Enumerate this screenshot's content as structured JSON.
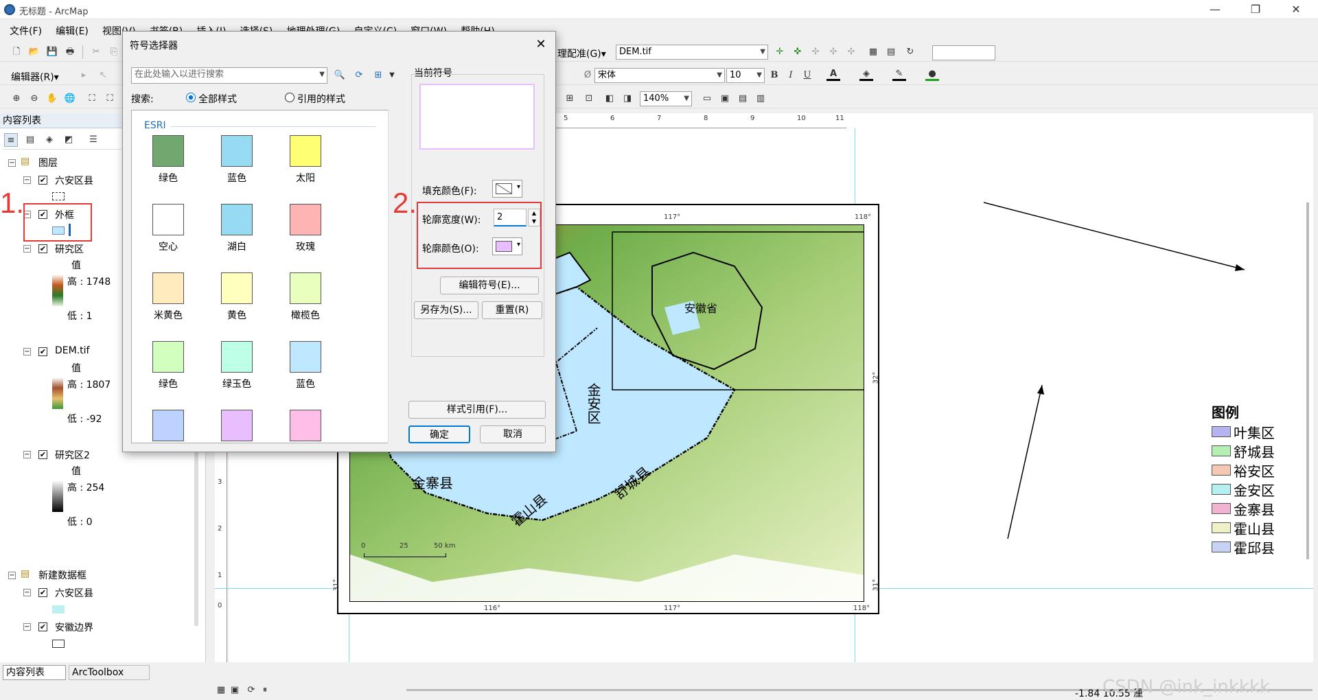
{
  "window": {
    "title": "无标题 - ArcMap",
    "min": "—",
    "max": "❐",
    "close": "✕"
  },
  "menu": [
    "文件(F)",
    "编辑(E)",
    "视图(V)",
    "书签(B)",
    "插入(I)",
    "选择(S)",
    "地理处理(G)",
    "自定义(C)",
    "窗口(W)",
    "帮助(H)"
  ],
  "toolbar": {
    "editor_label": "编辑器(R)▾",
    "georef_label": "理配准(G)▾",
    "georef_layer": "DEM.tif",
    "font_name": "宋体",
    "font_size": "10",
    "zoom": "140%",
    "bold": "B",
    "italic": "I",
    "underline": "U"
  },
  "toc": {
    "header": "内容列表",
    "layers_group": "图层",
    "layers": [
      {
        "name": "六安区县",
        "checked": true
      },
      {
        "name": "外框",
        "checked": true
      },
      {
        "name": "研究区",
        "checked": true,
        "value_label": "值",
        "high": "高 : 1748",
        "low": "低 : 1"
      },
      {
        "name": "DEM.tif",
        "checked": true,
        "value_label": "值",
        "high": "高 : 1807",
        "low": "低 : -92"
      },
      {
        "name": "研究区2",
        "checked": true,
        "value_label": "值",
        "high": "高 : 254",
        "low": "低 : 0"
      }
    ],
    "new_frame": "新建数据框",
    "new_frame_layers": [
      {
        "name": "六安区县",
        "checked": true
      },
      {
        "name": "安徽边界",
        "checked": true
      }
    ],
    "tabs": [
      "内容列表",
      "ArcToolbox"
    ]
  },
  "annotations": {
    "one": "1.",
    "two": "2."
  },
  "dialog": {
    "title": "符号选择器",
    "search_placeholder": "在此处输入以进行搜索",
    "search_label": "搜索:",
    "radio_all": "全部样式",
    "radio_ref": "引用的样式",
    "group": "ESRI",
    "symbols": [
      {
        "label": "绿色",
        "color": "#70a870"
      },
      {
        "label": "蓝色",
        "color": "#97dbf2"
      },
      {
        "label": "太阳",
        "color": "#ffff73"
      },
      {
        "label": "空心",
        "color": "#ffffff"
      },
      {
        "label": "湖白",
        "color": "#97dbf2"
      },
      {
        "label": "玫瑰",
        "color": "#ffb4b4"
      },
      {
        "label": "米黄色",
        "color": "#ffebbe"
      },
      {
        "label": "黄色",
        "color": "#ffffbe"
      },
      {
        "label": "橄榄色",
        "color": "#e9ffbe"
      },
      {
        "label": "绿色",
        "color": "#d3ffbe"
      },
      {
        "label": "绿玉色",
        "color": "#beffe8"
      },
      {
        "label": "蓝色",
        "color": "#bee8ff"
      },
      {
        "label": "",
        "color": "#bed2ff"
      },
      {
        "label": "",
        "color": "#e8beff"
      },
      {
        "label": "",
        "color": "#ffbee8"
      }
    ],
    "current_label": "当前符号",
    "fill_label": "填充颜色(F):",
    "outline_width_label": "轮廓宽度(W):",
    "outline_width_value": "2",
    "outline_color_label": "轮廓颜色(O):",
    "outline_color": "#e8beff",
    "edit_symbol": "编辑符号(E)...",
    "save_as": "另存为(S)...",
    "reset": "重置(R)",
    "style_ref": "样式引用(F)...",
    "ok": "确定",
    "cancel": "取消"
  },
  "map": {
    "ticks_top": [
      "117°",
      "118°"
    ],
    "ticks_bottom": [
      "116°",
      "117°",
      "118°"
    ],
    "ticks_side": [
      "32°",
      "31°",
      "31°"
    ],
    "ruler": [
      "5",
      "6",
      "7",
      "8",
      "9",
      "10",
      "11"
    ],
    "vruler": [
      "3",
      "2",
      "1",
      "0"
    ],
    "scale_labels": [
      "0",
      "25",
      "50 km"
    ],
    "counties": [
      "金寨县",
      "霍山县",
      "舒城县",
      "金安区"
    ],
    "inset_label": "安徽省",
    "legend_title": "图例",
    "legend": [
      {
        "label": "叶集区",
        "color": "#b4b4f0"
      },
      {
        "label": "舒城县",
        "color": "#b4f0b4"
      },
      {
        "label": "裕安区",
        "color": "#f5c8b4"
      },
      {
        "label": "金安区",
        "color": "#b4f0f0"
      },
      {
        "label": "金寨县",
        "color": "#f0b4d2"
      },
      {
        "label": "霍山县",
        "color": "#f0f0c8"
      },
      {
        "label": "霍邱县",
        "color": "#c8d2f5"
      }
    ]
  },
  "status": {
    "coords": "-1.84  10.55 厘",
    "watermark": "CSDN @ink_inkkkk"
  }
}
